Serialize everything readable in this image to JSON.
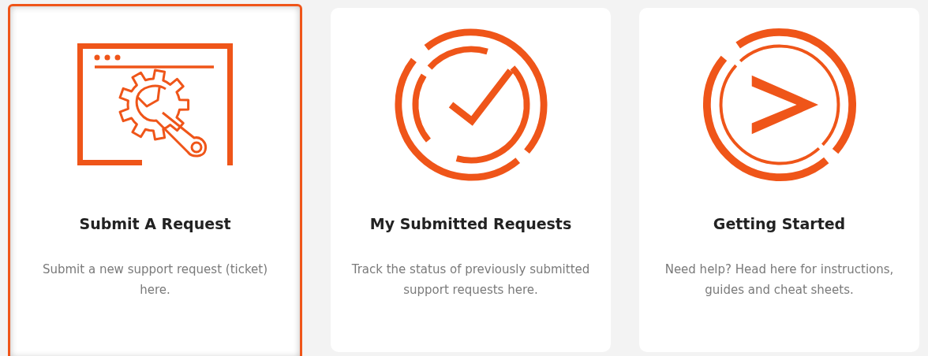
{
  "cards": [
    {
      "kind": "wrench",
      "title": "Submit A Request",
      "description": "Submit a new support request (ticket) here.",
      "selected": true
    },
    {
      "kind": "check",
      "title": "My Submitted Requests",
      "description": "Track the status of previously submitted support requests here.",
      "selected": false
    },
    {
      "kind": "play",
      "title": "Getting Started",
      "description": "Need help? Head here for instructions, guides and cheat sheets.",
      "selected": false
    }
  ]
}
